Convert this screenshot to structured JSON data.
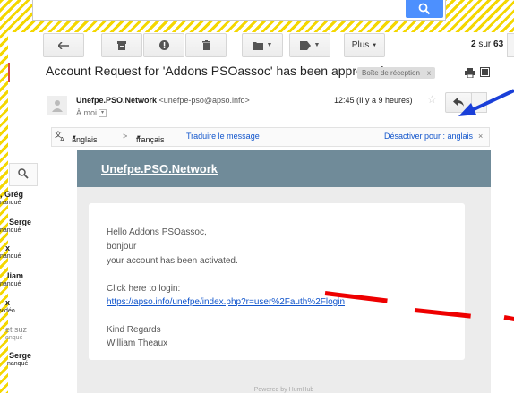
{
  "toolbar": {
    "more_label": "Plus",
    "page_current": "2",
    "page_sep": "sur",
    "page_total": "63"
  },
  "sidebar": {
    "contacts": [
      {
        "name": ", Grég",
        "status": "nanqué"
      },
      {
        "name": "Serge",
        "status": "nanqué"
      },
      {
        "name": "x",
        "status": "nanqué"
      },
      {
        "name": "liam",
        "status": "nanqué"
      },
      {
        "name": "x",
        "status": "vidéo"
      },
      {
        "name": "et suz",
        "status": "anqué"
      },
      {
        "name": "Serge",
        "status": "nanqué"
      }
    ]
  },
  "email": {
    "subject": "Account Request for 'Addons PSOassoc' has been approved.",
    "label_chip": "Boîte de réception",
    "label_close": "x",
    "sender_name": "Unefpe.PSO.Network",
    "sender_email": "<unefpe-pso@apso.info>",
    "to": "À moi",
    "time": "12:45 (Il y a 9 heures)"
  },
  "translate_bar": {
    "source_lang": "anglais",
    "arrow": ">",
    "target_lang": "français",
    "translate_link": "Traduire le message",
    "disable_link": "Désactiver pour : anglais",
    "close": "×"
  },
  "mail_body": {
    "header_title": "Unefpe.PSO.Network",
    "greeting": "Hello Addons PSOassoc,",
    "line2": "bonjour",
    "line3": "your account has been activated.",
    "login_prompt": "Click here to login:",
    "login_url": "https://apso.info/unefpe/index.php?r=user%2Fauth%2Flogin",
    "regards": "Kind Regards",
    "signature": "William Theaux",
    "footer": "Powered by HumHub"
  },
  "colors": {
    "header_bg": "#708b99",
    "link": "#1155cc",
    "search_button": "#4d90fe",
    "annotation_arrow": "#1a3fd8",
    "annotation_line": "#e00000"
  }
}
